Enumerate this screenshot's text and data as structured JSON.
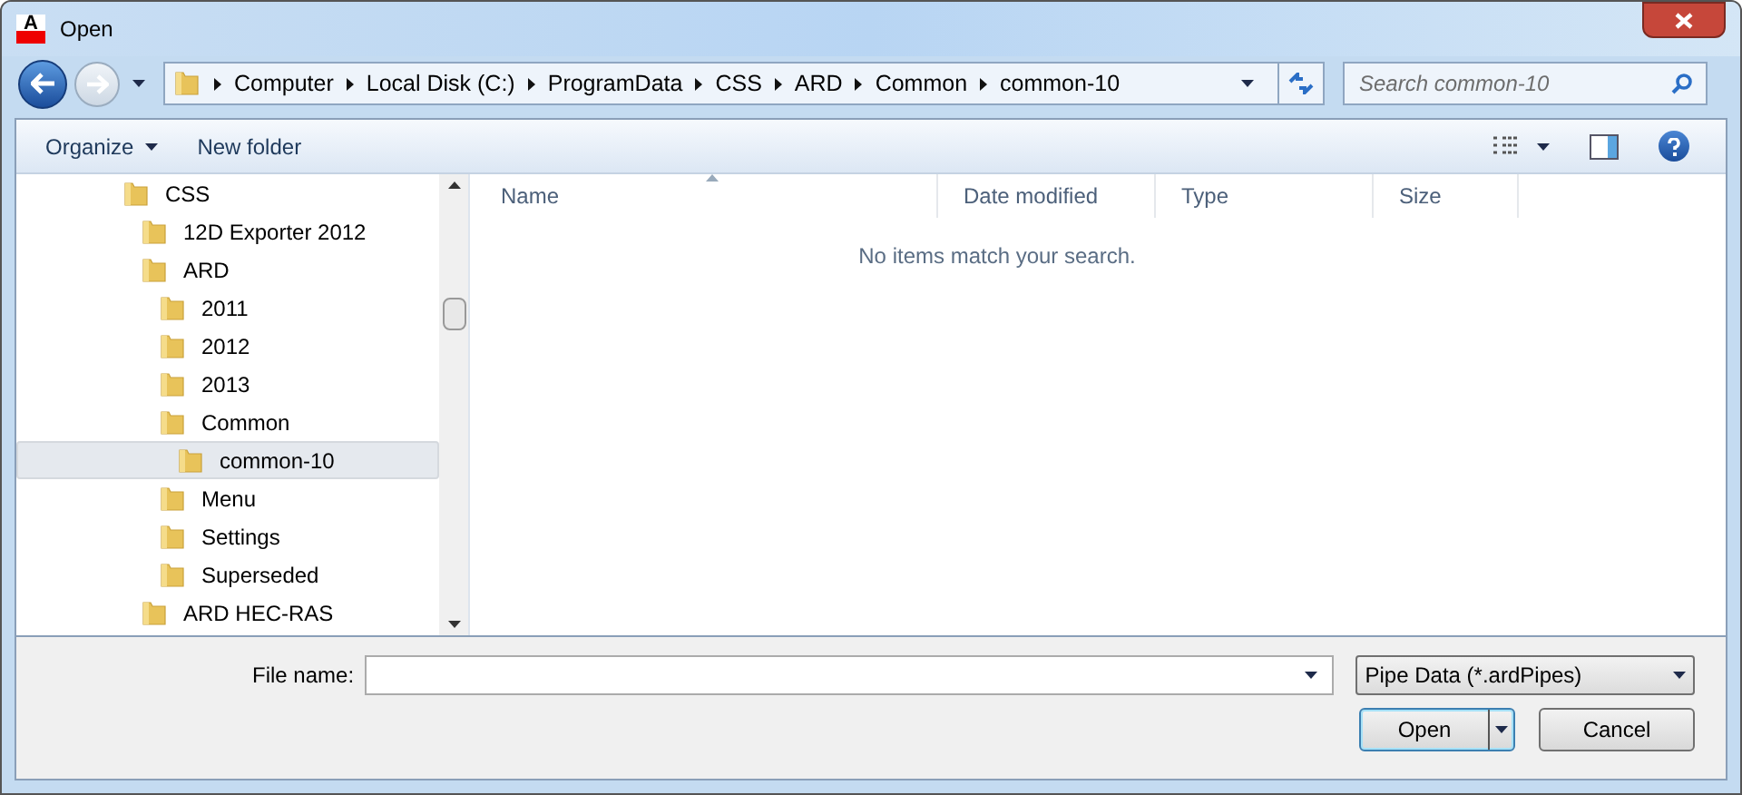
{
  "window": {
    "title": "Open",
    "app_icon": "A"
  },
  "address": {
    "crumbs": [
      "Computer",
      "Local Disk (C:)",
      "ProgramData",
      "CSS",
      "ARD",
      "Common",
      "common-10"
    ]
  },
  "search": {
    "placeholder": "Search common-10"
  },
  "toolbar": {
    "organize": "Organize",
    "new_folder": "New folder"
  },
  "tree": [
    {
      "label": "CSS",
      "selected": false,
      "children": [
        {
          "label": "12D Exporter 2012",
          "selected": false
        },
        {
          "label": "ARD",
          "selected": false,
          "children": [
            {
              "label": "2011",
              "selected": false
            },
            {
              "label": "2012",
              "selected": false
            },
            {
              "label": "2013",
              "selected": false
            },
            {
              "label": "Common",
              "selected": false,
              "children": [
                {
                  "label": "common-10",
                  "selected": true
                }
              ]
            },
            {
              "label": "Menu",
              "selected": false
            },
            {
              "label": "Settings",
              "selected": false
            },
            {
              "label": "Superseded",
              "selected": false
            }
          ]
        },
        {
          "label": "ARD HEC-RAS",
          "selected": false
        }
      ]
    }
  ],
  "columns": [
    {
      "label": "Name",
      "sorted": true
    },
    {
      "label": "Date modified",
      "sorted": false
    },
    {
      "label": "Type",
      "sorted": false
    },
    {
      "label": "Size",
      "sorted": false
    }
  ],
  "empty_message": "No items match your search.",
  "file_name": {
    "label": "File name:"
  },
  "file_type": {
    "value": "Pipe Data (*.ardPipes)"
  },
  "buttons": [
    {
      "label": "Open",
      "kind": "split",
      "default": true
    },
    {
      "label": "Cancel",
      "kind": "plain",
      "default": false
    }
  ]
}
